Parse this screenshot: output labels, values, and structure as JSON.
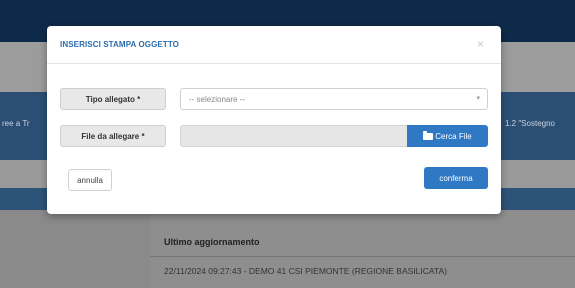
{
  "background": {
    "left_text": "ree a Tr",
    "right_text": "1.2 \"Sostegno",
    "heading": "Ultimo aggiornamento",
    "updated": "22/11/2024 09:27:43 - DEMO 41 CSI PIEMONTE (REGIONE BASILICATA)"
  },
  "modal": {
    "title": "INSERISCI STAMPA OGGETTO",
    "close": "×",
    "tipo_label": "Tipo allegato *",
    "tipo_value": "-- selezionare --",
    "file_label": "File da allegare *",
    "file_value": "",
    "file_button": "Cerca File",
    "cancel": "annulla",
    "confirm": "conferma"
  },
  "colors": {
    "accent": "#2f78c4",
    "title": "#2b6cb0",
    "topbar": "#0e2a4a"
  }
}
